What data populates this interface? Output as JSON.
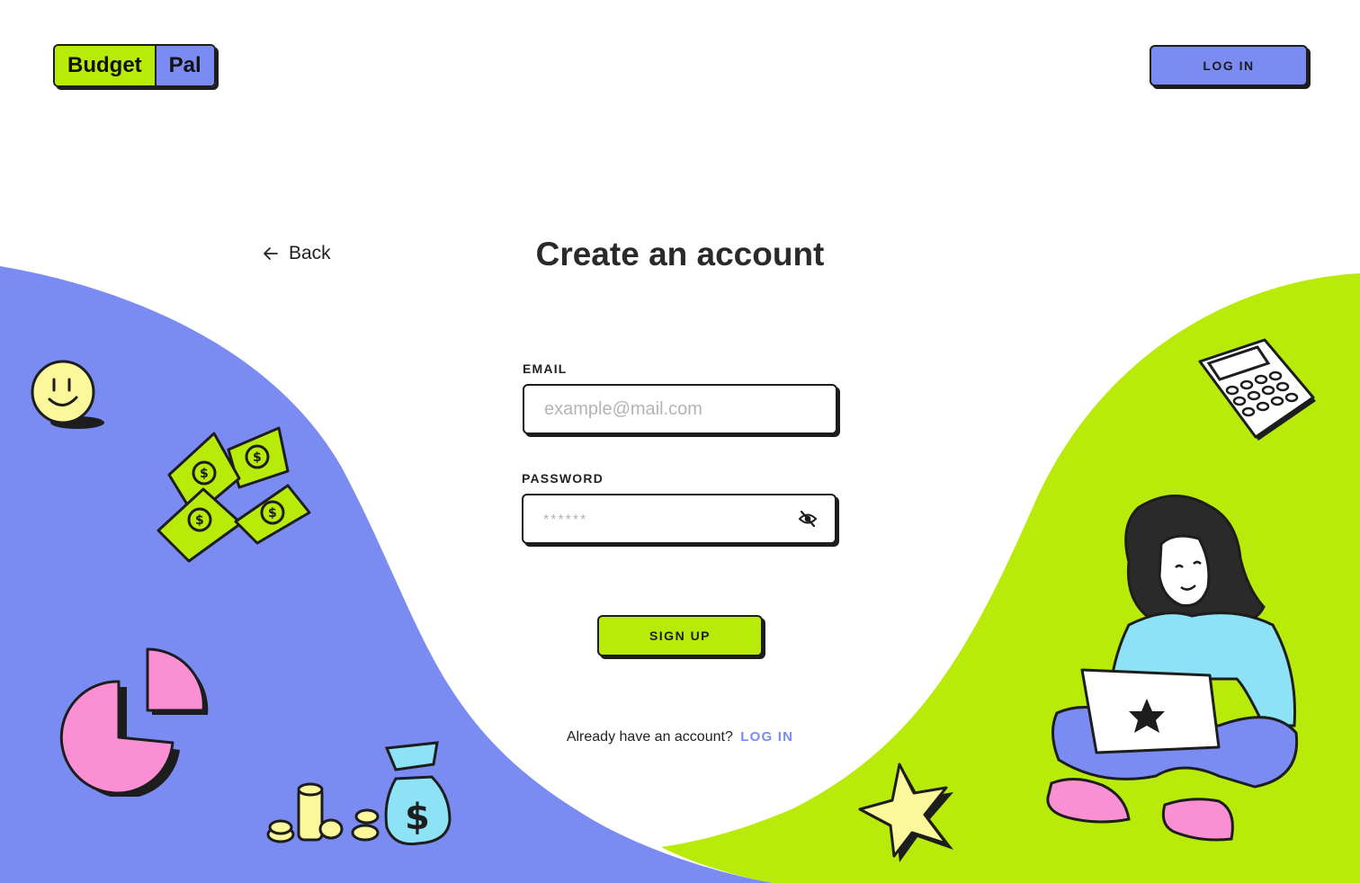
{
  "header": {
    "logo_left": "Budget",
    "logo_right": "Pal",
    "login_button": "LOG IN"
  },
  "nav": {
    "back_label": "Back"
  },
  "page": {
    "title": "Create an account"
  },
  "form": {
    "email_label": "EMAIL",
    "email_placeholder": "example@mail.com",
    "email_value": "",
    "password_label": "PASSWORD",
    "password_placeholder": "******",
    "password_value": "",
    "signup_button": "SIGN UP"
  },
  "footer": {
    "already_text": "Already have an account?",
    "login_link": "LOG IN"
  },
  "icons": [
    "arrow-left-icon",
    "eye-off-icon"
  ],
  "colors": {
    "blue": "#7a8bf2",
    "lime": "#b9eb0a",
    "ink": "#1d1d1d"
  }
}
